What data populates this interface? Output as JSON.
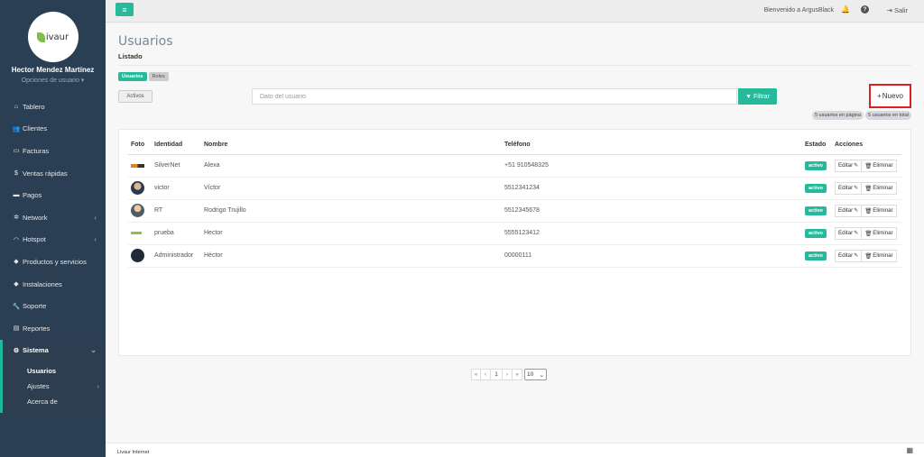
{
  "sidebar": {
    "logo_text": "ivaur",
    "user_name": "Hector Mendez Martinez",
    "user_options": "Opciones de usuario ▾",
    "items": [
      {
        "label": "Tablero",
        "icon": "dashboard-icon",
        "glyph": "⌂"
      },
      {
        "label": "Clientes",
        "icon": "users-icon",
        "glyph": "👥"
      },
      {
        "label": "Facturas",
        "icon": "file-icon",
        "glyph": "▭"
      },
      {
        "label": "Ventas rápidas",
        "icon": "dollar-icon",
        "glyph": "$"
      },
      {
        "label": "Pagos",
        "icon": "money-icon",
        "glyph": "▬"
      },
      {
        "label": "Network",
        "icon": "network-icon",
        "glyph": "✲"
      },
      {
        "label": "Hotspot",
        "icon": "wifi-icon",
        "glyph": "◠"
      },
      {
        "label": "Productos y servicios",
        "icon": "tags-icon",
        "glyph": "◆"
      },
      {
        "label": "Instalaciones",
        "icon": "tag-icon",
        "glyph": "◆"
      },
      {
        "label": "Soporte",
        "icon": "wrench-icon",
        "glyph": "🔧"
      },
      {
        "label": "Reportes",
        "icon": "book-icon",
        "glyph": "▤"
      }
    ],
    "active_item": {
      "label": "Sistema",
      "icon": "cogs-icon",
      "glyph": "⚙"
    },
    "subitems": [
      {
        "label": "Usuarios"
      },
      {
        "label": "Ajustes"
      },
      {
        "label": "Acerca de"
      }
    ]
  },
  "topnav": {
    "menu_glyph": "≡",
    "welcome": "Bienvenido a ArgusBlack",
    "bell_glyph": "🔔",
    "help_glyph": "?",
    "logout_glyph": "⇥",
    "logout_label": "Salir"
  },
  "page": {
    "title": "Usuarios",
    "subtitle": "Listado",
    "tabs": [
      "Usuarios",
      "Roles"
    ],
    "filter_toggle": "Activos",
    "search_placeholder": "Dato del usuario",
    "filter_button": "Filtrar",
    "filter_glyph": "▼",
    "new_button": "Nuevo",
    "plus_glyph": "+",
    "count_page": "5 usuarios en página",
    "count_total": "5 usuarios en total"
  },
  "table": {
    "headers": [
      "Foto",
      "Identidad",
      "Nombre",
      "Teléfono",
      "Estado",
      "Acciones"
    ],
    "rows": [
      {
        "identity": "SilverNet",
        "name": "Alexa",
        "phone": "+51 910548325",
        "status": "activo"
      },
      {
        "identity": "victor",
        "name": "Víctor",
        "phone": "5512341234",
        "status": "activo"
      },
      {
        "identity": "RT",
        "name": "Rodrigo Trujillo",
        "phone": "5512345678",
        "status": "activo"
      },
      {
        "identity": "prueba",
        "name": "Hector",
        "phone": "5555123412",
        "status": "activo"
      },
      {
        "identity": "Administrador",
        "name": "Héctor",
        "phone": "00000111",
        "status": "activo"
      }
    ],
    "edit_label": "Editar",
    "edit_glyph": "✎",
    "delete_label": "Eliminar",
    "delete_glyph": "🗑"
  },
  "pagination": {
    "first": "«",
    "prev": "‹",
    "current": "1",
    "next": "›",
    "last": "»",
    "page_size": "10"
  },
  "footer": {
    "text": "Livaur Internet",
    "icon_glyph": "▦"
  },
  "colors": {
    "accent": "#26b99a",
    "sidebar": "#2a3f54",
    "highlight": "#e02020"
  }
}
